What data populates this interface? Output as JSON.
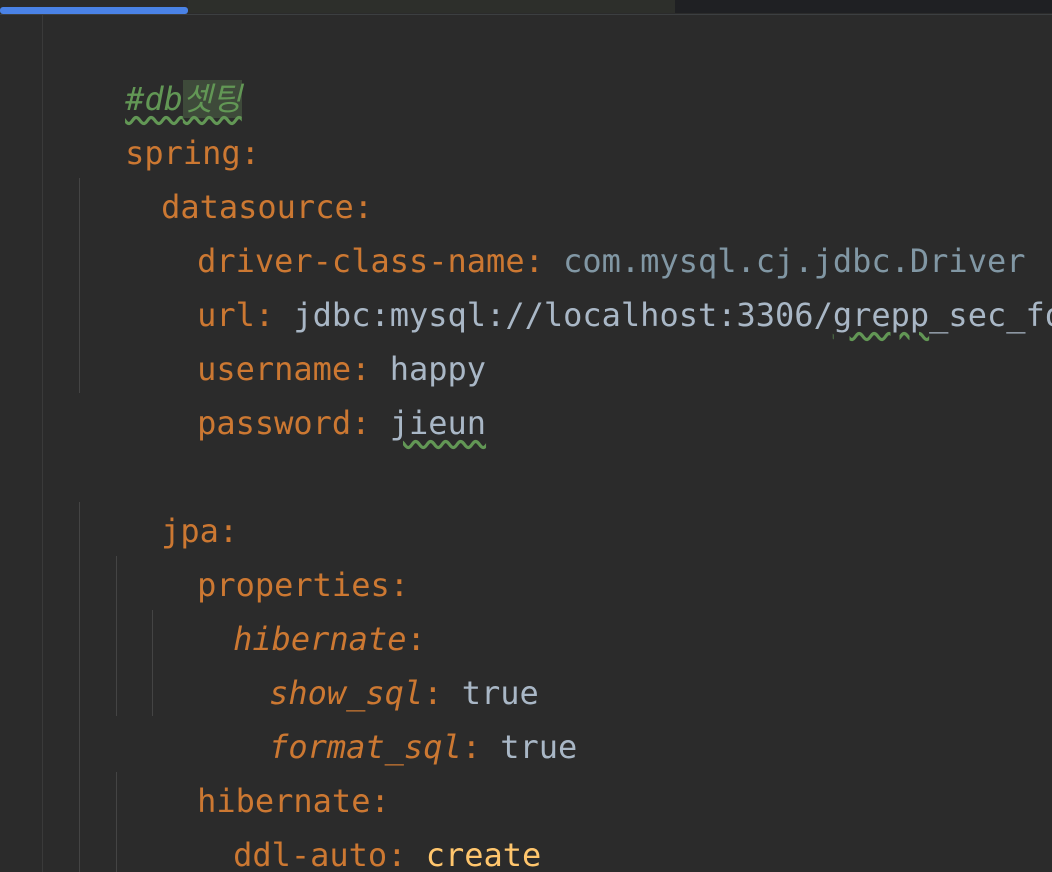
{
  "editor": {
    "language": "yaml",
    "lines": {
      "l1": {
        "comment": "#db",
        "comment_hl": "셋팅"
      },
      "l2": {
        "key": "spring",
        "colon": ":"
      },
      "l3": {
        "key": "datasource",
        "colon": ":"
      },
      "l4": {
        "key": "driver-class-name",
        "colon": ":",
        "value": "com.mysql.cj.jdbc.Driver"
      },
      "l5": {
        "key": "url",
        "colon": ":",
        "value_a": "jdbc:mysql://localhost:3306/",
        "value_typo": "grepp",
        "value_b": "_sec_form"
      },
      "l6": {
        "key": "username",
        "colon": ":",
        "value": "happy"
      },
      "l7": {
        "key": "password",
        "colon": ":",
        "value": "jieun"
      },
      "l9": {
        "key": "jpa",
        "colon": ":"
      },
      "l10": {
        "key": "properties",
        "colon": ":"
      },
      "l11": {
        "key": "hibernate",
        "colon": ":"
      },
      "l12": {
        "key": "show_sql",
        "colon": ":",
        "value": "true"
      },
      "l13": {
        "key": "format_sql",
        "colon": ":",
        "value": "true"
      },
      "l14": {
        "key": "hibernate",
        "colon": ":"
      },
      "l15": {
        "key": "ddl-auto",
        "colon": ":",
        "value": "create"
      }
    }
  },
  "colors": {
    "background": "#2b2b2b",
    "key": "#cc7832",
    "value": "#a9b7c6",
    "class_value": "#8197a4",
    "keyword_value": "#ffc66d",
    "comment": "#629755",
    "progress": "#4a82e6"
  }
}
